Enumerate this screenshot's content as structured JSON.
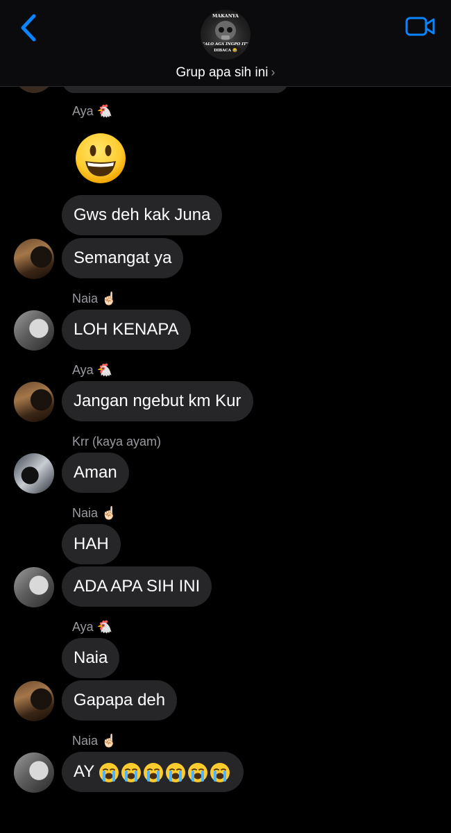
{
  "header": {
    "group_name": "Grup apa sih ini",
    "chevron": "›",
    "avatar_lines": {
      "top": "MAKANYA",
      "middle": "\"ALO AGA INGPO IT\"",
      "bottom": "DIBACA 😂"
    },
    "back_icon": "chevron-left-icon",
    "video_icon": "video-camera-icon",
    "accent_color": "#0a84ff"
  },
  "messages": [
    {
      "sender": "Aya 🐔"
    },
    {
      "text": "Gws deh kak Juna"
    },
    {
      "text": "Semangat ya"
    },
    {
      "sender": "Naia ☝🏻"
    },
    {
      "text": "LOH KENAPA"
    },
    {
      "sender": "Aya 🐔"
    },
    {
      "text": "Jangan ngebut km Kur"
    },
    {
      "sender": "Krr (kaya ayam)"
    },
    {
      "text": "Aman"
    },
    {
      "sender": "Naia ☝🏻"
    },
    {
      "text": "HAH"
    },
    {
      "text": "ADA APA SIH INI"
    },
    {
      "sender": "Aya 🐔"
    },
    {
      "text": "Naia"
    },
    {
      "text": "Gapapa deh"
    },
    {
      "sender": "Naia ☝🏻"
    },
    {
      "text": "AY"
    }
  ],
  "big_emoji": "smiling-face-icon",
  "crying_emoji_count": 6,
  "colors": {
    "background": "#000000",
    "bubble": "#262629",
    "sender_label": "#9a9aa0",
    "header_bg": "#0b0b0d"
  }
}
